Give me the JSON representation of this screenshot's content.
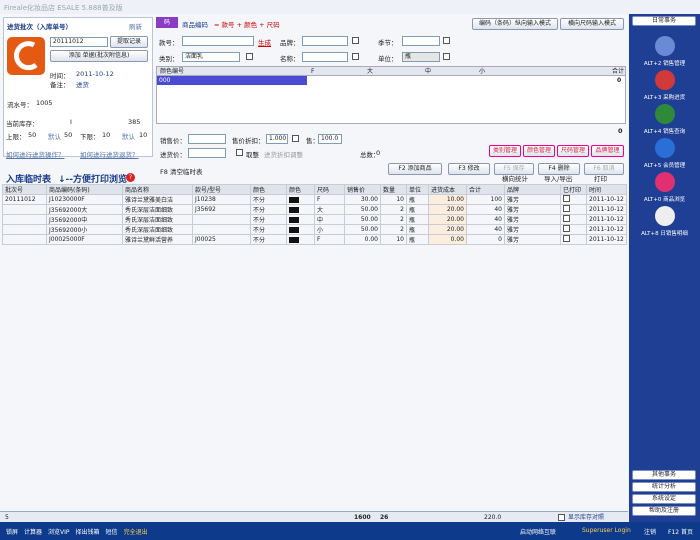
{
  "title": "Fireale化妆品店 ESALE 5.888普及版",
  "left": {
    "batch_header": "进货批次（入库单号）",
    "refresh": "刷新",
    "batch_no": "20111012",
    "fetch_btn": "提取记录",
    "add_btn": "添加 单据(批次附信息)",
    "time_label": "时间：",
    "time_value": "2011-10-12",
    "note_label": "备注：",
    "note_value": "进货",
    "serial_label": "流水号：",
    "serial_value": "1005",
    "stock_label": "当前库存：",
    "stock_value": "I",
    "stock_unit": "385",
    "upper_label": "上限：",
    "upper_value": "50",
    "default1": "默认",
    "val50": "50",
    "lower_label": "下限：",
    "lower_value": "10",
    "default2": "默认",
    "val10": "10",
    "link1": "如何进行进货操作？",
    "link2": "如何进行进货退货？"
  },
  "form": {
    "code_label": "商品编码",
    "hint": "= 款号 + 颜色 + 尺码",
    "mode1": "编码（条码）纵向输入模式",
    "mode2": "横向尺码输入模式",
    "style_label": "款号：",
    "generate": "生成",
    "brand_label": "品牌：",
    "season_label": "季节：",
    "category_label": "类别：",
    "category_value": "洁面乳",
    "name_label": "名称：",
    "unit_label": "单位：",
    "unit_value": "瓶",
    "price_label": "销售价：",
    "discount_label": "售价折扣：",
    "discount_value": "1.000",
    "sale_label": "售：",
    "sale_value": "100.0",
    "cost_label": "进货价：",
    "allow_label": "取整",
    "allow_hint": "进货折扣调整",
    "total_label": "总数：",
    "total_value": "0",
    "fill_count": "0",
    "clear_label": "F8 清空临时表",
    "mgmt": [
      "类别管理",
      "颜色管理",
      "尺码管理",
      "品牌管理"
    ],
    "buttons": {
      "add": "F2 添加商品",
      "edit": "F3 修改",
      "save": "F5 保存",
      "delete": "F4 删除",
      "cancel": "F6 取消"
    }
  },
  "size_grid": {
    "headers": [
      "颜色编号",
      "F",
      "大",
      "中",
      "小",
      "合计"
    ],
    "row": "000",
    "total": "0"
  },
  "temp": {
    "title": "入库临时表",
    "subtitle": "↓--方便打印浏览",
    "help": "?",
    "tools": [
      "横向统计",
      "导入/导出",
      "打印"
    ]
  },
  "table": {
    "columns": [
      "批次号",
      "商品编码(条码)",
      "商品名称",
      "款号/型号",
      "颜色",
      "颜色",
      "尺码",
      "销售价",
      "数量",
      "单位",
      "进货成本",
      "合计",
      "品牌",
      "已打印",
      "时间"
    ],
    "rows": [
      [
        "20111012",
        "J10230000F",
        "雅诗兰黛雅美白洁",
        "J10238",
        "不分",
        "",
        "F",
        "30.00",
        "10",
        "瓶",
        "10.00",
        "100",
        "雅芳",
        "",
        "2011-10-12"
      ],
      [
        "",
        "J35692000大",
        "秀氏深层洁面细致",
        "J35692",
        "不分",
        "",
        "大",
        "50.00",
        "2",
        "瓶",
        "20.00",
        "40",
        "雅芳",
        "",
        "2011-10-12"
      ],
      [
        "",
        "J35692000中",
        "秀氏深层洁面细致",
        "",
        "不分",
        "",
        "中",
        "50.00",
        "2",
        "瓶",
        "20.00",
        "40",
        "雅芳",
        "",
        "2011-10-12"
      ],
      [
        "",
        "J35692000小",
        "秀氏深层洁面细致",
        "",
        "不分",
        "",
        "小",
        "50.00",
        "2",
        "瓶",
        "20.00",
        "40",
        "雅芳",
        "",
        "2011-10-12"
      ],
      [
        "",
        "J00025000F",
        "雅诗兰黛鲜活营养",
        "J00025",
        "不分",
        "",
        "F",
        "0.00",
        "10",
        "瓶",
        "0.00",
        "0",
        "雅芳",
        "",
        "2011-10-12"
      ]
    ]
  },
  "sum": {
    "count": "5",
    "sale": "1600",
    "qty": "26",
    "cost": "220.0",
    "show_stock": "显示库存对照"
  },
  "right": {
    "top": "日常事务",
    "nav": [
      {
        "label": "ALT+2 销售管理",
        "color": "#6a8ad6"
      },
      {
        "label": "ALT+3 采购进货",
        "color": "#d23a3a"
      },
      {
        "label": "ALT+4 销售查询",
        "color": "#2e8a3a"
      },
      {
        "label": "ALT+5 会员管理",
        "color": "#2a6fd6"
      },
      {
        "label": "ALT+0 商品浏览",
        "color": "#e03070"
      },
      {
        "label": "ALT+8 日销售明细",
        "color": "#eeeeee"
      }
    ],
    "bottom": [
      "其他事务",
      "统计分析",
      "系统设定",
      "帮助及注册"
    ]
  },
  "status": {
    "items": [
      "锁屏",
      "计算器",
      "浏览VIP",
      "择出钱箱",
      "短信",
      "完全退出"
    ],
    "net": "启动网络互联",
    "user": "Superuser Login",
    "logout": "注销",
    "f12": "F12 首页"
  }
}
